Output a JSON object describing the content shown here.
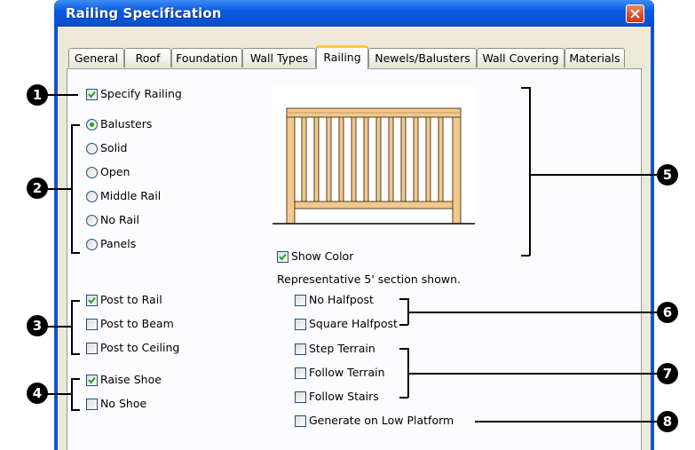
{
  "window": {
    "title": "Railing Specification"
  },
  "tabs": [
    "General",
    "Roof",
    "Foundation",
    "Wall Types",
    "Railing",
    "Newels/Balusters",
    "Wall Covering",
    "Materials"
  ],
  "active_tab": "Railing",
  "specify_railing": {
    "label": "Specify Railing",
    "checked": true
  },
  "railing_types": [
    {
      "label": "Balusters",
      "selected": true
    },
    {
      "label": "Solid",
      "selected": false
    },
    {
      "label": "Open",
      "selected": false
    },
    {
      "label": "Middle Rail",
      "selected": false
    },
    {
      "label": "No Rail",
      "selected": false
    },
    {
      "label": "Panels",
      "selected": false
    }
  ],
  "preview": {
    "show_color_label": "Show Color",
    "show_color_checked": true,
    "note": "Representative 5' section shown."
  },
  "post_options": [
    {
      "label": "Post to Rail",
      "checked": true
    },
    {
      "label": "Post to Beam",
      "checked": false
    },
    {
      "label": "Post to Ceiling",
      "checked": false
    }
  ],
  "shoe_options": [
    {
      "label": "Raise Shoe",
      "checked": true
    },
    {
      "label": "No Shoe",
      "checked": false
    }
  ],
  "halfpost_options": [
    {
      "label": "No Halfpost",
      "checked": false
    },
    {
      "label": "Square Halfpost",
      "checked": false
    }
  ],
  "terrain_options": [
    {
      "label": "Step Terrain",
      "checked": false
    },
    {
      "label": "Follow Terrain",
      "checked": false
    },
    {
      "label": "Follow Stairs",
      "checked": false
    }
  ],
  "low_platform": {
    "label": "Generate on Low Platform",
    "checked": false
  },
  "callouts": [
    "1",
    "2",
    "3",
    "4",
    "5",
    "6",
    "7",
    "8"
  ],
  "colors": {
    "title_bar": "#0a53d8",
    "dialog_bg": "#ece9d8",
    "active_tab_accent": "#ffc83c",
    "check_mark": "#21a121",
    "close_button": "#d94a24",
    "railing_wood": "#f0c98e"
  }
}
